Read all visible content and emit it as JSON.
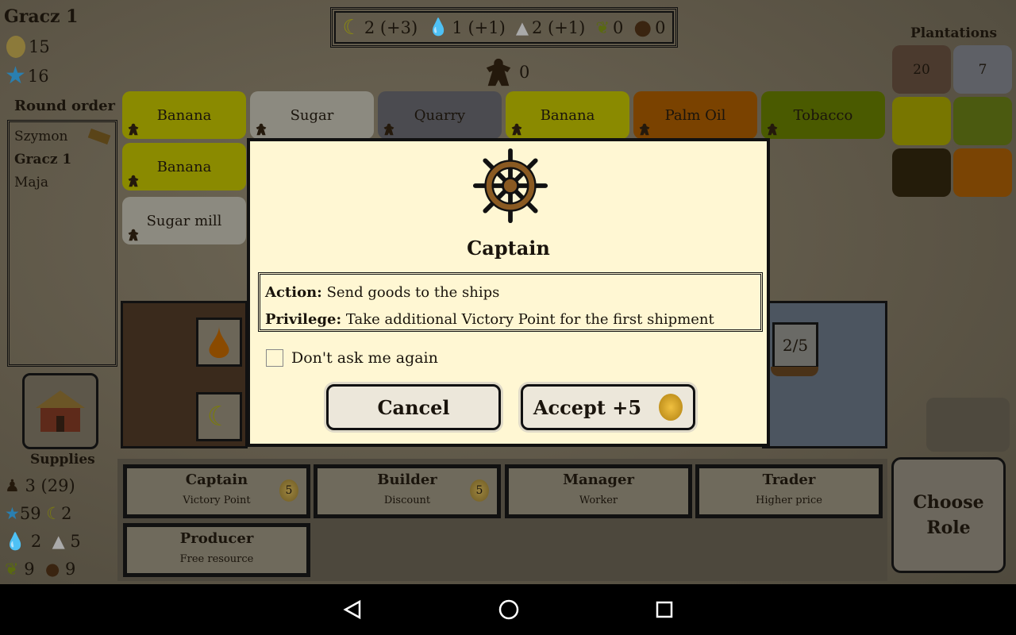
{
  "player": {
    "name": "Gracz 1",
    "gold": "15",
    "vp": "16"
  },
  "resources_bar": [
    {
      "icon": "banana-icon",
      "text": "2 (+3)"
    },
    {
      "icon": "oil-drop-icon",
      "text": "1 (+1)"
    },
    {
      "icon": "sugar-icon",
      "text": "2 (+1)"
    },
    {
      "icon": "tobacco-leaf-icon",
      "text": "0"
    },
    {
      "icon": "coffee-bean-icon",
      "text": "0"
    }
  ],
  "colonists": "0",
  "round_order": {
    "title": "Round order",
    "players": [
      "Szymon",
      "Gracz 1",
      "Maja"
    ],
    "current": "Gracz 1"
  },
  "plantation_tiles": [
    {
      "label": "Banana",
      "color": "#8a8a00"
    },
    {
      "label": "Sugar",
      "color": "#8c8a80"
    },
    {
      "label": "Quarry",
      "color": "#4b4b50"
    },
    {
      "label": "Banana",
      "color": "#8a8a00"
    },
    {
      "label": "Palm Oil",
      "color": "#7a4200"
    },
    {
      "label": "Tobacco",
      "color": "#4a5a00"
    }
  ],
  "my_tiles": [
    {
      "label": "Banana",
      "color": "#8a8a00"
    },
    {
      "label": "Sugar mill",
      "color": "#8c8a80"
    }
  ],
  "plantations": {
    "title": "Plantations",
    "tiles": [
      {
        "text": "20",
        "color": "#4b3a2e"
      },
      {
        "text": "7",
        "color": "#5e6066"
      },
      {
        "text": "",
        "color": "#787600"
      },
      {
        "text": "",
        "color": "#4b5a10"
      },
      {
        "text": "",
        "color": "#241c0a"
      },
      {
        "text": "",
        "color": "#7a4404"
      }
    ]
  },
  "ship": {
    "cargo": "2/5"
  },
  "supplies": {
    "title": "Supplies",
    "colonists": "3 (29)",
    "vp": "59",
    "banana": "2",
    "oil": "2",
    "sugar": "5",
    "tobacco": "9",
    "coffee": "9"
  },
  "roles": [
    {
      "title": "Captain",
      "subtitle": "Victory Point",
      "bonus": "5"
    },
    {
      "title": "Builder",
      "subtitle": "Discount",
      "bonus": "5"
    },
    {
      "title": "Manager",
      "subtitle": "Worker",
      "bonus": ""
    },
    {
      "title": "Trader",
      "subtitle": "Higher price",
      "bonus": ""
    },
    {
      "title": "Producer",
      "subtitle": "Free resource",
      "bonus": ""
    }
  ],
  "choose_role": "Choose Role",
  "dialog": {
    "title": "Captain",
    "action_label": "Action:",
    "action_text": "Send goods to the ships",
    "privilege_label": "Privilege:",
    "privilege_text": "Take additional Victory Point for the first shipment",
    "checkbox_label": "Don't ask me again",
    "checkbox_checked": false,
    "cancel": "Cancel",
    "accept": "Accept +5"
  }
}
